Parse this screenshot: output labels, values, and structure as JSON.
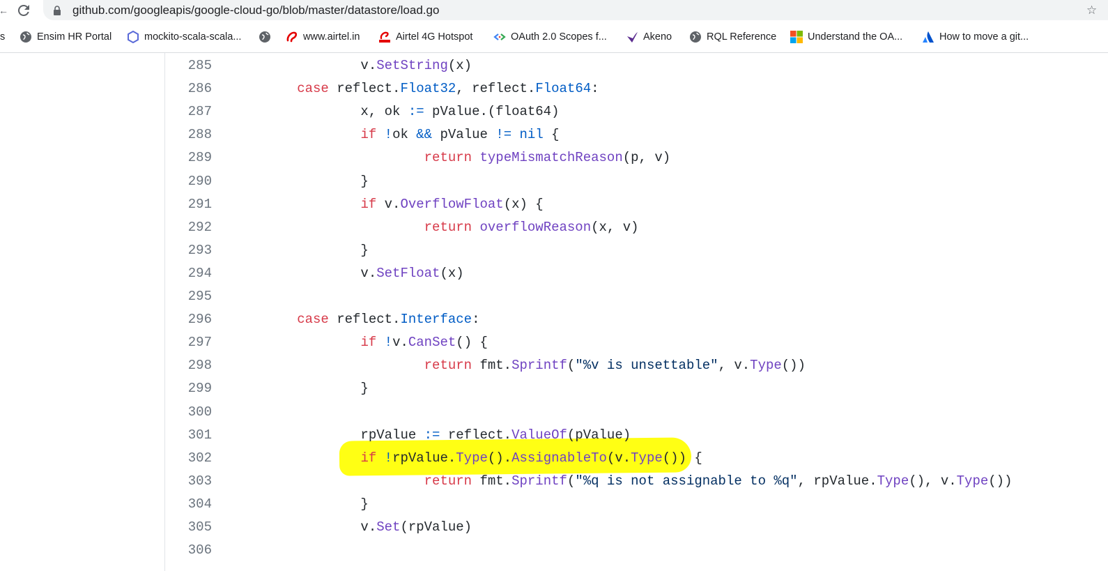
{
  "browser": {
    "url": "github.com/googleapis/google-cloud-go/blob/master/datastore/load.go"
  },
  "bookmarks": [
    {
      "label": "Ensim HR Portal",
      "icon": "globe-icon"
    },
    {
      "label": "mockito-scala-scala...",
      "icon": "hexagon-icon"
    },
    {
      "label": "",
      "icon": "globe-icon"
    },
    {
      "label": "www.airtel.in",
      "icon": "airtel-icon"
    },
    {
      "label": "Airtel 4G Hotspot",
      "icon": "airtel-icon"
    },
    {
      "label": "OAuth 2.0 Scopes f...",
      "icon": "google-dev-icon"
    },
    {
      "label": "Akeno",
      "icon": "akeno-icon"
    },
    {
      "label": "RQL Reference",
      "icon": "globe-icon"
    },
    {
      "label": "Understand the OA...",
      "icon": "microsoft-icon"
    },
    {
      "label": "How to move a git...",
      "icon": "atlassian-icon"
    }
  ],
  "code": {
    "lines": [
      {
        "num": "285",
        "tokens": [
          {
            "t": "                v."
          },
          {
            "t": "SetString",
            "c": "fn"
          },
          {
            "t": "(x)"
          }
        ]
      },
      {
        "num": "286",
        "tokens": [
          {
            "t": "        "
          },
          {
            "t": "case",
            "c": "kw"
          },
          {
            "t": " reflect."
          },
          {
            "t": "Float32",
            "c": "ty"
          },
          {
            "t": ", reflect."
          },
          {
            "t": "Float64",
            "c": "ty"
          },
          {
            "t": ":"
          }
        ]
      },
      {
        "num": "287",
        "tokens": [
          {
            "t": "                x, ok "
          },
          {
            "t": ":=",
            "c": "ty"
          },
          {
            "t": " pValue.(float64)"
          }
        ]
      },
      {
        "num": "288",
        "tokens": [
          {
            "t": "                "
          },
          {
            "t": "if",
            "c": "kw"
          },
          {
            "t": " "
          },
          {
            "t": "!",
            "c": "ty"
          },
          {
            "t": "ok "
          },
          {
            "t": "&&",
            "c": "ty"
          },
          {
            "t": " pValue "
          },
          {
            "t": "!=",
            "c": "ty"
          },
          {
            "t": " "
          },
          {
            "t": "nil",
            "c": "ty"
          },
          {
            "t": " {"
          }
        ]
      },
      {
        "num": "289",
        "tokens": [
          {
            "t": "                        "
          },
          {
            "t": "return",
            "c": "kw"
          },
          {
            "t": " "
          },
          {
            "t": "typeMismatchReason",
            "c": "fn"
          },
          {
            "t": "(p, v)"
          }
        ]
      },
      {
        "num": "290",
        "tokens": [
          {
            "t": "                }"
          }
        ]
      },
      {
        "num": "291",
        "tokens": [
          {
            "t": "                "
          },
          {
            "t": "if",
            "c": "kw"
          },
          {
            "t": " v."
          },
          {
            "t": "OverflowFloat",
            "c": "fn"
          },
          {
            "t": "(x) {"
          }
        ]
      },
      {
        "num": "292",
        "tokens": [
          {
            "t": "                        "
          },
          {
            "t": "return",
            "c": "kw"
          },
          {
            "t": " "
          },
          {
            "t": "overflowReason",
            "c": "fn"
          },
          {
            "t": "(x, v)"
          }
        ]
      },
      {
        "num": "293",
        "tokens": [
          {
            "t": "                }"
          }
        ]
      },
      {
        "num": "294",
        "tokens": [
          {
            "t": "                v."
          },
          {
            "t": "SetFloat",
            "c": "fn"
          },
          {
            "t": "(x)"
          }
        ]
      },
      {
        "num": "295",
        "tokens": []
      },
      {
        "num": "296",
        "tokens": [
          {
            "t": "        "
          },
          {
            "t": "case",
            "c": "kw"
          },
          {
            "t": " reflect."
          },
          {
            "t": "Interface",
            "c": "ty"
          },
          {
            "t": ":"
          }
        ]
      },
      {
        "num": "297",
        "tokens": [
          {
            "t": "                "
          },
          {
            "t": "if",
            "c": "kw"
          },
          {
            "t": " "
          },
          {
            "t": "!",
            "c": "ty"
          },
          {
            "t": "v."
          },
          {
            "t": "CanSet",
            "c": "fn"
          },
          {
            "t": "() {"
          }
        ]
      },
      {
        "num": "298",
        "tokens": [
          {
            "t": "                        "
          },
          {
            "t": "return",
            "c": "kw"
          },
          {
            "t": " fmt."
          },
          {
            "t": "Sprintf",
            "c": "fn"
          },
          {
            "t": "("
          },
          {
            "t": "\"%v is unsettable\"",
            "c": "st"
          },
          {
            "t": ", v."
          },
          {
            "t": "Type",
            "c": "fn"
          },
          {
            "t": "())"
          }
        ]
      },
      {
        "num": "299",
        "tokens": [
          {
            "t": "                }"
          }
        ]
      },
      {
        "num": "300",
        "tokens": []
      },
      {
        "num": "301",
        "tokens": [
          {
            "t": "                rpValue "
          },
          {
            "t": ":=",
            "c": "ty"
          },
          {
            "t": " reflect."
          },
          {
            "t": "ValueOf",
            "c": "fn"
          },
          {
            "t": "(pValue)"
          }
        ]
      },
      {
        "num": "302",
        "tokens": [
          {
            "t": "                "
          },
          {
            "t": "if",
            "c": "kw"
          },
          {
            "t": " "
          },
          {
            "t": "!",
            "c": "ty"
          },
          {
            "t": "rpValue."
          },
          {
            "t": "Type",
            "c": "fn"
          },
          {
            "t": "()."
          },
          {
            "t": "AssignableTo",
            "c": "fn"
          },
          {
            "t": "(v."
          },
          {
            "t": "Type",
            "c": "fn"
          },
          {
            "t": "()) {"
          }
        ]
      },
      {
        "num": "303",
        "tokens": [
          {
            "t": "                        "
          },
          {
            "t": "return",
            "c": "kw"
          },
          {
            "t": " fmt."
          },
          {
            "t": "Sprintf",
            "c": "fn"
          },
          {
            "t": "("
          },
          {
            "t": "\"%q is not assignable to %q\"",
            "c": "st"
          },
          {
            "t": ", rpValue."
          },
          {
            "t": "Type",
            "c": "fn"
          },
          {
            "t": "(), v."
          },
          {
            "t": "Type",
            "c": "fn"
          },
          {
            "t": "())"
          }
        ]
      },
      {
        "num": "304",
        "tokens": [
          {
            "t": "                }"
          }
        ]
      },
      {
        "num": "305",
        "tokens": [
          {
            "t": "                v."
          },
          {
            "t": "Set",
            "c": "fn"
          },
          {
            "t": "(rpValue)"
          }
        ]
      },
      {
        "num": "306",
        "tokens": []
      }
    ],
    "highlighted_line": "302",
    "highlight_color": "#ffff14"
  }
}
